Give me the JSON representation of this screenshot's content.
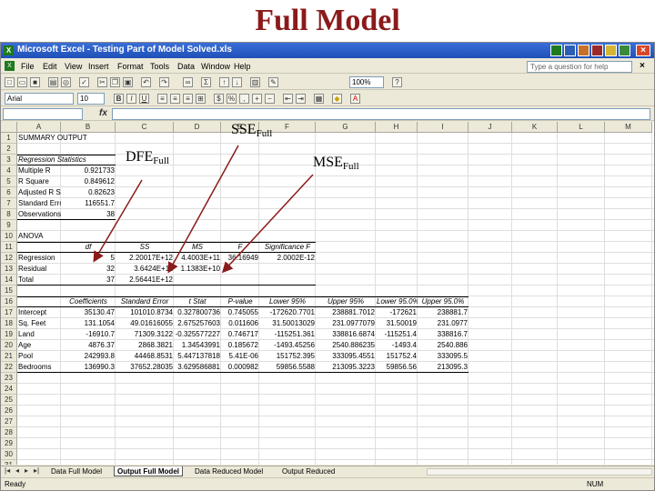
{
  "slide": {
    "title": "Full Model"
  },
  "window": {
    "title": "Microsoft Excel - Testing Part of Model Solved.xls"
  },
  "menu": [
    "File",
    "Edit",
    "View",
    "Insert",
    "Format",
    "Tools",
    "Data",
    "Window",
    "Help"
  ],
  "help_placeholder": "Type a question for help",
  "zoom": "100%",
  "font": {
    "name": "Arial",
    "size": "10"
  },
  "columns": [
    "A",
    "B",
    "C",
    "D",
    "E",
    "F",
    "G",
    "H",
    "I",
    "J",
    "K",
    "L",
    "M"
  ],
  "rows": [
    "1",
    "2",
    "3",
    "4",
    "5",
    "6",
    "7",
    "8",
    "9",
    "10",
    "11",
    "12",
    "13",
    "14",
    "15",
    "16",
    "17",
    "18",
    "19",
    "20",
    "21",
    "22",
    "23",
    "24",
    "25",
    "26",
    "27",
    "28",
    "29",
    "30",
    "31"
  ],
  "sheet": {
    "summary_output": "SUMMARY OUTPUT",
    "regression_statistics": "Regression Statistics",
    "stats": [
      {
        "label": "Multiple R",
        "value": "0.921733"
      },
      {
        "label": "R Square",
        "value": "0.849612"
      },
      {
        "label": "Adjusted R Square",
        "value": "0.82623"
      },
      {
        "label": "Standard Error",
        "value": "116551.7"
      },
      {
        "label": "Observations",
        "value": "38"
      }
    ],
    "anova": "ANOVA",
    "anova_headers": [
      "df",
      "SS",
      "MS",
      "F",
      "Significance F"
    ],
    "anova_rows": [
      {
        "label": "Regression",
        "df": "5",
        "ss": "2.20017E+12",
        "ms": "4.4003E+11",
        "f": "36.16949",
        "sigf": "2.0002E-12"
      },
      {
        "label": "Residual",
        "df": "32",
        "ss": "3.6424E+11",
        "ms": "1.1383E+10",
        "f": "",
        "sigf": ""
      },
      {
        "label": "Total",
        "df": "37",
        "ss": "2.56441E+12",
        "ms": "",
        "f": "",
        "sigf": ""
      }
    ],
    "coef_headers": [
      "Coefficients",
      "Standard Error",
      "t Stat",
      "P-value",
      "Lower 95%",
      "Upper 95%",
      "Lower 95.0%",
      "Upper 95.0%"
    ],
    "coef_rows": [
      {
        "label": "Intercept",
        "v": [
          "35130.47",
          "101010.8734",
          "0.327800736",
          "0.745055",
          "-172620.7701",
          "238881.7012",
          "-172621",
          "238881.7"
        ]
      },
      {
        "label": "Sq. Feet",
        "v": [
          "131.1054",
          "49.01616055",
          "2.675257603",
          "0.011606",
          "31.50013029",
          "231.0977079",
          "31.50019",
          "231.0977"
        ]
      },
      {
        "label": "Land",
        "v": [
          "-16910.7",
          "71309.3122",
          "-0.325577227",
          "0.746717",
          "-115251.361",
          "338816.6874",
          "-115251.4",
          "338816.7"
        ]
      },
      {
        "label": "Age",
        "v": [
          "4876.37",
          "2868.3821",
          "1.34543991",
          "0.185672",
          "-1493.45256",
          "2540.886235",
          "-1493.4",
          "2540.886"
        ]
      },
      {
        "label": "Pool",
        "v": [
          "242993.8",
          "44468.8531",
          "5.447137818",
          "5.41E-06",
          "151752.395",
          "333095.4551",
          "151752.4",
          "333095.5"
        ]
      },
      {
        "label": "Bedrooms",
        "v": [
          "136990.3",
          "37652.28035",
          "3.629586881",
          "0.000982",
          "59856.5588",
          "213095.3223",
          "59856.56",
          "213095.3"
        ]
      }
    ]
  },
  "tabs": [
    "Data Full Model",
    "Output Full Model",
    "Data Reduced Model",
    "Output Reduced"
  ],
  "active_tab": "Output Full Model",
  "status": {
    "left": "Ready",
    "right": "NUM"
  },
  "annotations": {
    "sse": {
      "main": "SSE",
      "sub": "Full"
    },
    "dfe": {
      "main": "DFE",
      "sub": "Full"
    },
    "mse": {
      "main": "MSE",
      "sub": "Full"
    }
  },
  "colors": {
    "title": "#8b1a1a",
    "arrow": "#8b1a1a",
    "titlebar": "#2a5cc8"
  }
}
